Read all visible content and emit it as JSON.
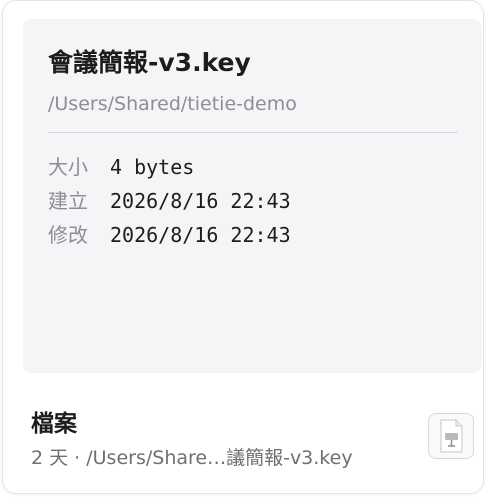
{
  "preview": {
    "title": "會議簡報-v3.key",
    "path": "/Users/Shared/tietie-demo",
    "meta": [
      {
        "label": "大小",
        "value": "4 bytes"
      },
      {
        "label": "建立",
        "value": "2026/8/16 22:43"
      },
      {
        "label": "修改",
        "value": "2026/8/16 22:43"
      }
    ]
  },
  "footer": {
    "kind": "檔案",
    "subtitle": "2 天 · /Users/Share…議簡報-v3.key",
    "icon": "keynote-file-icon"
  },
  "colors": {
    "preview_bg": "#f5f5f7",
    "title": "#1d1d1f",
    "secondary": "#8e8e93"
  }
}
